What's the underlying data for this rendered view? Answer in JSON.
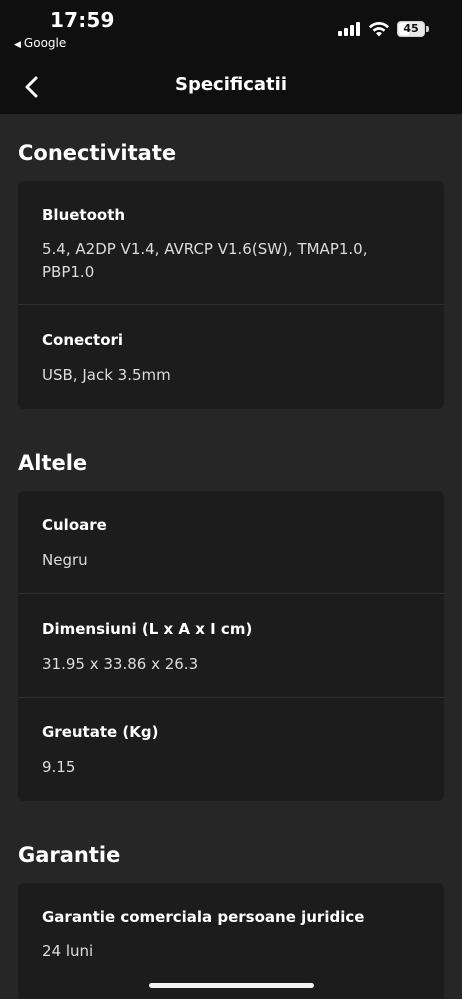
{
  "status_bar": {
    "time": "17:59",
    "back_app": "Google",
    "battery": "45",
    "battery_level": 0.45
  },
  "nav": {
    "title": "Specificatii",
    "back_icon": "chevron-left-icon"
  },
  "sections": [
    {
      "title": "Conectivitate",
      "rows": [
        {
          "label": "Bluetooth",
          "value": "5.4, A2DP V1.4, AVRCP V1.6(SW), TMAP1.0, PBP1.0"
        },
        {
          "label": "Conectori",
          "value": "USB, Jack 3.5mm"
        }
      ]
    },
    {
      "title": "Altele",
      "rows": [
        {
          "label": "Culoare",
          "value": "Negru"
        },
        {
          "label": "Dimensiuni (L x A x I cm)",
          "value": "31.95 x 33.86 x 26.3"
        },
        {
          "label": "Greutate (Kg)",
          "value": "9.15"
        }
      ]
    },
    {
      "title": "Garantie",
      "rows": [
        {
          "label": "Garantie comerciala persoane juridice",
          "value": "24 luni"
        }
      ]
    }
  ],
  "colors": {
    "header_bg": "#0f0f0f",
    "page_bg": "#262626",
    "card_bg": "#1c1c1c"
  }
}
